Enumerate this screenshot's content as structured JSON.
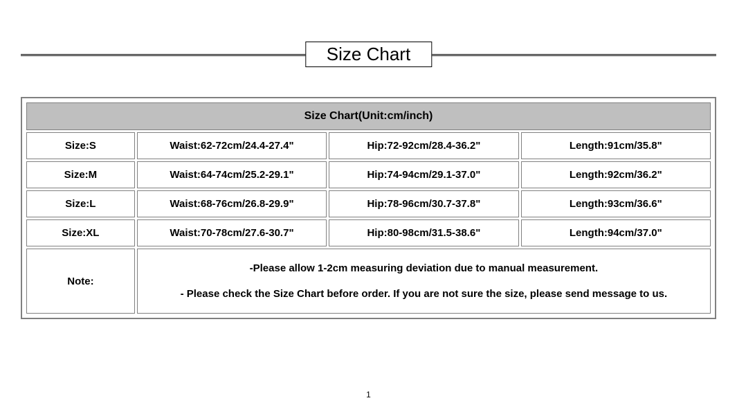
{
  "title": "Size Chart",
  "table_header": "Size Chart(Unit:cm/inch)",
  "rows": [
    {
      "size": "Size:S",
      "waist": "Waist:62-72cm/24.4-27.4\"",
      "hip": "Hip:72-92cm/28.4-36.2\"",
      "length": "Length:91cm/35.8\""
    },
    {
      "size": "Size:M",
      "waist": "Waist:64-74cm/25.2-29.1\"",
      "hip": "Hip:74-94cm/29.1-37.0\"",
      "length": "Length:92cm/36.2\""
    },
    {
      "size": "Size:L",
      "waist": "Waist:68-76cm/26.8-29.9\"",
      "hip": "Hip:78-96cm/30.7-37.8\"",
      "length": "Length:93cm/36.6\""
    },
    {
      "size": "Size:XL",
      "waist": "Waist:70-78cm/27.6-30.7\"",
      "hip": "Hip:80-98cm/31.5-38.6\"",
      "length": "Length:94cm/37.0\""
    }
  ],
  "note_label": "Note:",
  "note_line1": "-Please allow 1-2cm measuring deviation due to manual measurement.",
  "note_line2": "- Please check the Size Chart before order. If you are not sure the size, please send message to us.",
  "page_number": "1"
}
